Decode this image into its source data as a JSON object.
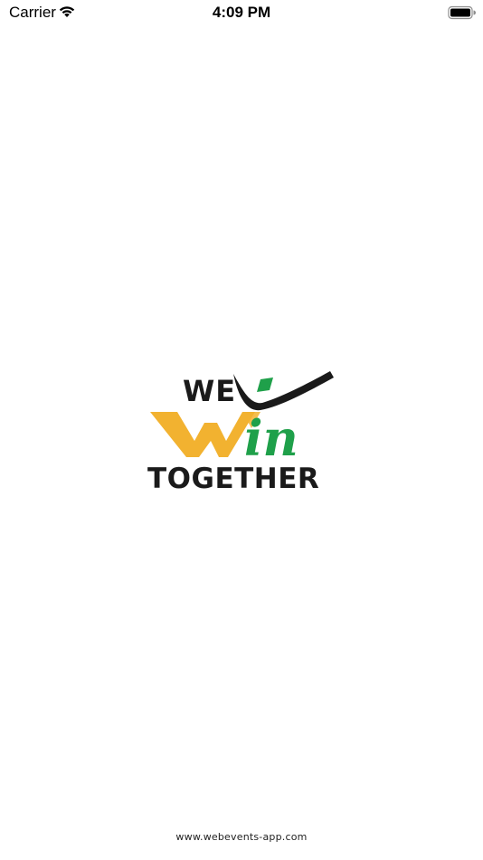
{
  "status_bar": {
    "carrier": "Carrier",
    "time": "4:09 PM",
    "wifi_icon": "wifi-icon",
    "battery_icon": "battery-icon"
  },
  "logo": {
    "line1": "WE",
    "line2": "in",
    "line3": "TOGETHER",
    "colors": {
      "black": "#1a1a1a",
      "gold": "#f2b230",
      "green": "#1fa04a"
    }
  },
  "footer": {
    "text": "www.webevents-app.com"
  }
}
